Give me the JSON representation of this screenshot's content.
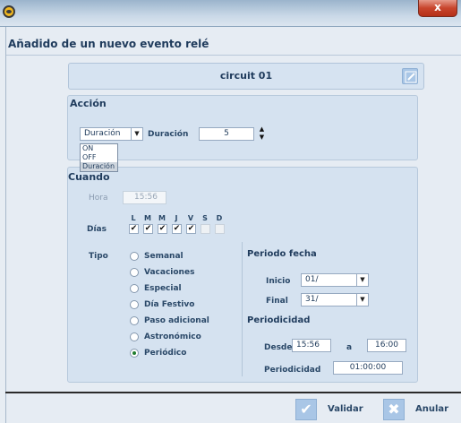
{
  "titlebar": {
    "close_glyph": "x"
  },
  "window": {
    "title": "Añadido de un nuevo evento relé"
  },
  "circuit": {
    "name": "circuit 01"
  },
  "accion": {
    "title": "Acción",
    "select_value": "Duración",
    "duration_label": "Duración",
    "duration_value": "5",
    "dropdown_options": [
      "ON",
      "OFF",
      "Duración"
    ],
    "selected_option": "Duración"
  },
  "cuando": {
    "title": "Cuando",
    "hora_label": "Hora",
    "hora_value": "15:56",
    "dias_label": "Días",
    "days": [
      {
        "letter": "L",
        "checked": true
      },
      {
        "letter": "M",
        "checked": true
      },
      {
        "letter": "M",
        "checked": true
      },
      {
        "letter": "J",
        "checked": true
      },
      {
        "letter": "V",
        "checked": true
      },
      {
        "letter": "S",
        "checked": false
      },
      {
        "letter": "D",
        "checked": false
      }
    ],
    "tipo_label": "Tipo",
    "tipo_options": [
      "Semanal",
      "Vacaciones",
      "Especial",
      "Día Festivo",
      "Paso adicional",
      "Astronómico",
      "Periódico"
    ],
    "tipo_selected": "Periódico"
  },
  "periodo": {
    "title": "Periodo fecha",
    "inicio_label": "Inicio",
    "inicio_value": "01/",
    "final_label": "Final",
    "final_value": "31/"
  },
  "periodicidad": {
    "title": "Periodicidad",
    "desde_label": "Desde",
    "desde_value": "15:56",
    "a_label": "a",
    "a_value": "16:00",
    "periodicidad_label": "Periodicidad",
    "periodicidad_value": "01:00:00"
  },
  "footer": {
    "validar_label": "Validar",
    "anular_label": "Anular"
  },
  "colors": {
    "titlebar": "#c9d8e7",
    "panel": "#d5e2f0",
    "accent_button": "#a9c6e6",
    "close": "#c8452d",
    "radio_checked": "#1f7d2e"
  },
  "icons": [
    "app-icon",
    "close-icon",
    "edit-icon",
    "chevron-down-icon",
    "spin-up-icon",
    "spin-down-icon",
    "check-icon",
    "x-icon"
  ]
}
